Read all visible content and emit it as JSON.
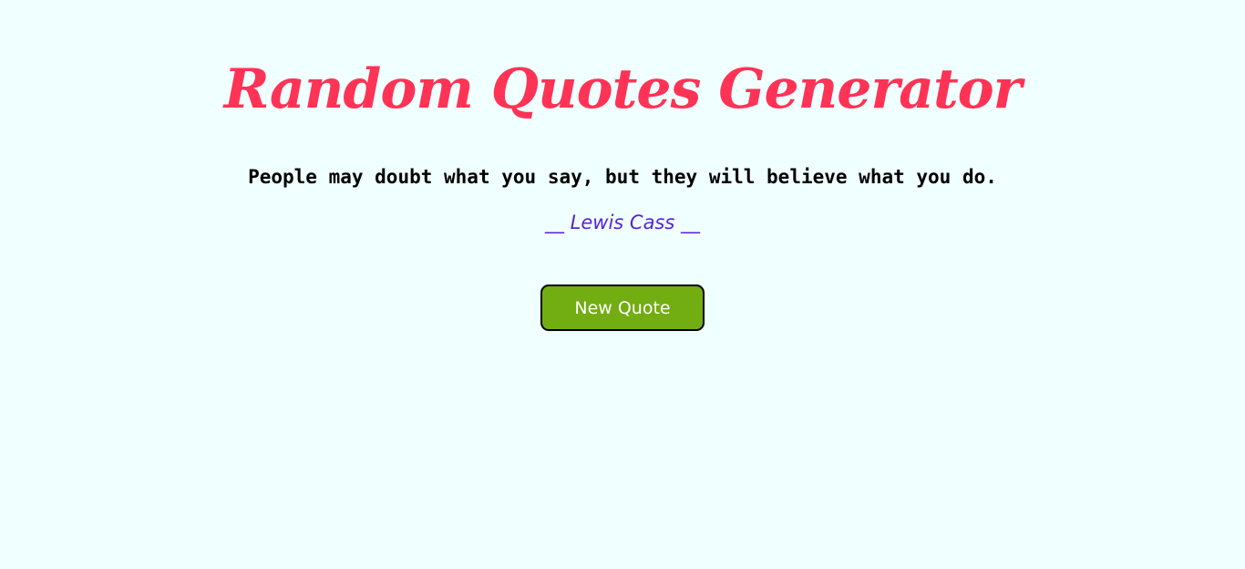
{
  "header": {
    "title": "Random Quotes Generator"
  },
  "quote": {
    "text": "People may doubt what you say, but they will believe what you do.",
    "author": "__ Lewis Cass __"
  },
  "actions": {
    "new_quote_label": "New Quote"
  },
  "colors": {
    "background": "#f0ffff",
    "title": "#ff3355",
    "author": "#5522dd",
    "button": "#72ad12"
  }
}
